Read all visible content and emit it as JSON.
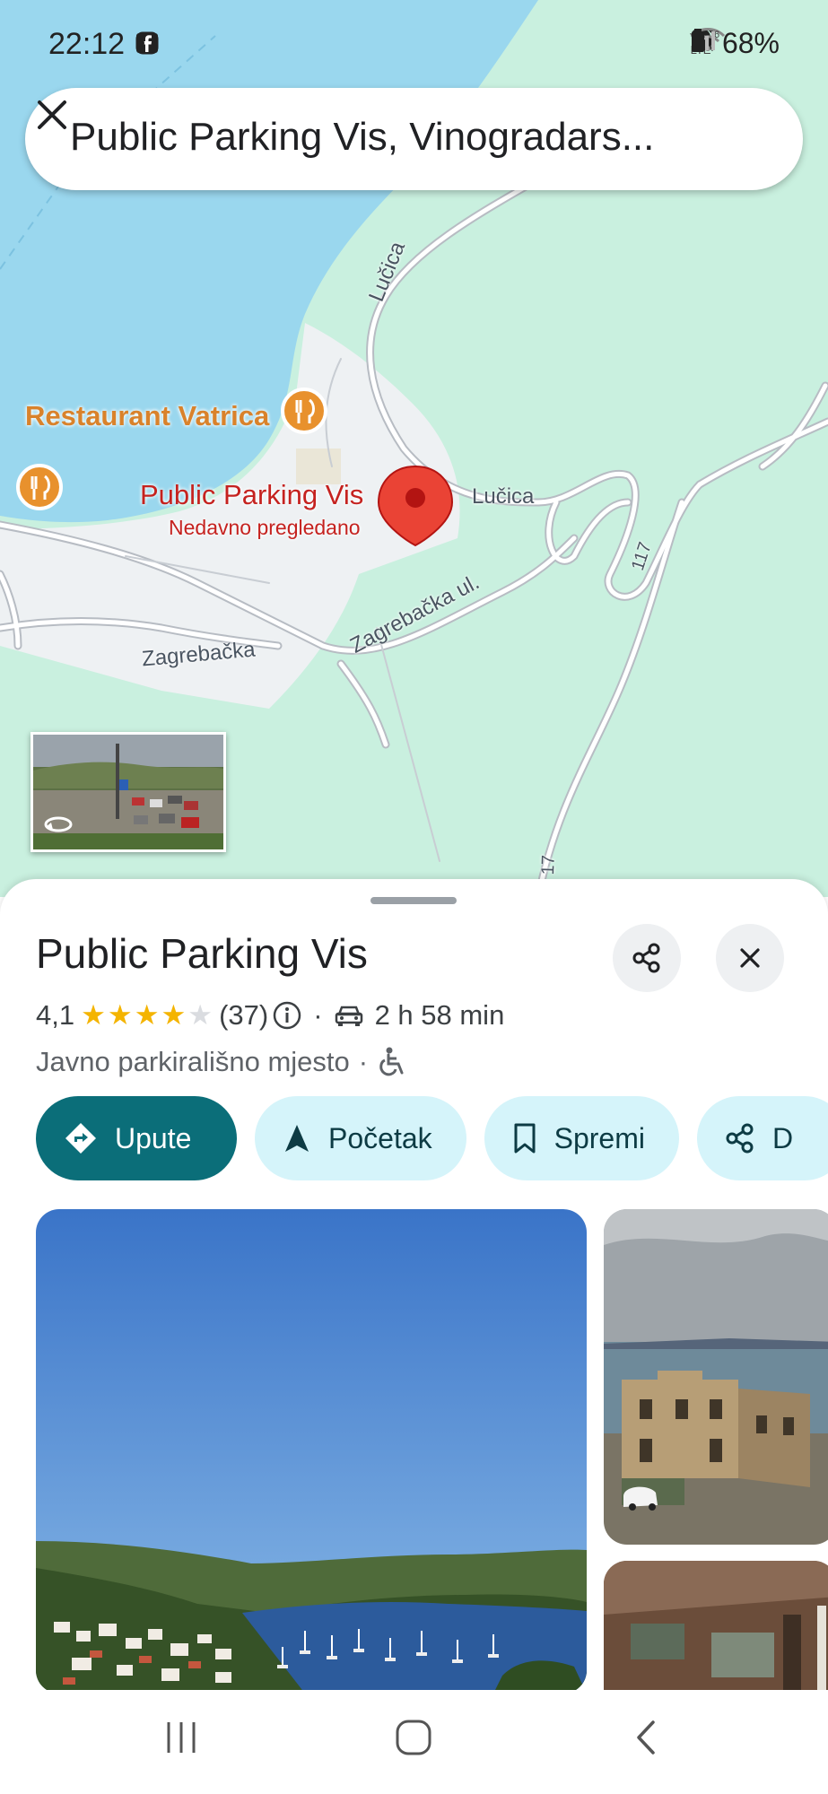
{
  "status_bar": {
    "time": "22:12",
    "battery": "68%",
    "network_lte": "LTE",
    "left_icons": [
      "image-icon",
      "instagram-icon",
      "facebook-icon",
      "dot-icon"
    ],
    "right_icons": [
      "alarm-icon",
      "mute-icon",
      "location-icon",
      "wifi-icon",
      "volte-icon",
      "signal-icon",
      "battery-icon"
    ]
  },
  "search": {
    "query": "Public Parking Vis, Vinogradars..."
  },
  "map": {
    "restaurant_label": "Restaurant Vatrica",
    "pin_name": "Public Parking Vis",
    "pin_subtitle": "Nedavno pregledano",
    "roads": {
      "lucica_1": "Lučica",
      "lucica_2": "Lučica",
      "zagrebacka": "Zagrebačka",
      "zagrebacka_ul": "Zagrebačka ul.",
      "route_117": "117",
      "route_117_b": "17"
    },
    "colors": {
      "water": "#9ad7ee",
      "land": "#c9f0df",
      "urban": "#eef1f3"
    }
  },
  "place": {
    "title": "Public Parking Vis",
    "rating": "4,1",
    "stars_filled": 4,
    "stars_total": 5,
    "review_count": "(37)",
    "drive_time": "2 h 58 min",
    "category": "Javno parkirališno mjesto",
    "category_separator": "·",
    "rating_separator": "·"
  },
  "actions": {
    "directions": "Upute",
    "start": "Početak",
    "save": "Spremi",
    "share": "D"
  },
  "colors": {
    "primary_chip": "#0b6e79",
    "secondary_chip": "#d5f4fa",
    "pin_red": "#c5221f",
    "restaurant_orange": "#e8912d",
    "star_gold": "#f4b400"
  }
}
